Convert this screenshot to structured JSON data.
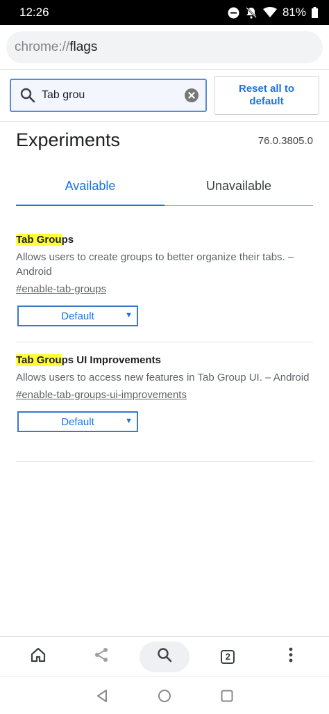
{
  "status_bar": {
    "time": "12:26",
    "battery": "81%"
  },
  "omnibox": {
    "scheme": "chrome://",
    "path": "flags"
  },
  "search": {
    "value": "Tab grou",
    "reset_label": "Reset all to default"
  },
  "header": {
    "title": "Experiments",
    "version": "76.0.3805.0"
  },
  "tabs": [
    {
      "label": "Available",
      "selected": true
    },
    {
      "label": "Unavailable",
      "selected": false
    }
  ],
  "experiments": [
    {
      "title_highlight": "Tab Grou",
      "title_rest": "ps",
      "description": "Allows users to create groups to better organize their tabs. – Android",
      "link": "#enable-tab-groups",
      "select_value": "Default"
    },
    {
      "title_highlight": "Tab Grou",
      "title_rest": "ps UI Improvements",
      "description": "Allows users to access new features in Tab Group UI. – Android",
      "link": "#enable-tab-groups-ui-improvements",
      "select_value": "Default"
    }
  ],
  "bottom_toolbar": {
    "tab_count": "2"
  },
  "colors": {
    "accent": "#1a73e8",
    "highlight": "#ffff33"
  }
}
